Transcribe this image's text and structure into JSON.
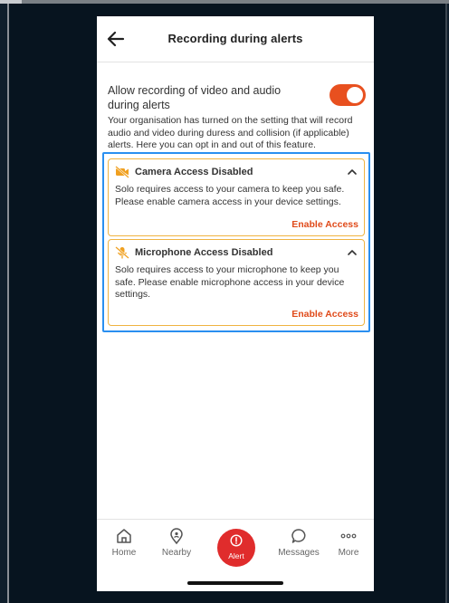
{
  "header": {
    "title": "Recording during alerts",
    "back_icon": "arrow-left-icon"
  },
  "setting": {
    "label": "Allow recording of video and audio during alerts",
    "enabled": true,
    "note": "Your organisation has turned on the setting that will record audio and video during duress and collision (if applicable) alerts. Here you can opt in and out of this feature."
  },
  "cards": [
    {
      "icon": "camera-off-icon",
      "title": "Camera Access Disabled",
      "body": "Solo requires access to your camera to keep you safe. Please enable camera access in your device settings.",
      "action": "Enable Access"
    },
    {
      "icon": "microphone-off-icon",
      "title": "Microphone Access Disabled",
      "body": "Solo requires access to your microphone to keep you safe. Please enable microphone access in your device settings.",
      "action": "Enable Access"
    }
  ],
  "nav": {
    "home": "Home",
    "nearby": "Nearby",
    "alert": "Alert",
    "messages": "Messages",
    "more": "More"
  },
  "colors": {
    "accent": "#e8501f",
    "card_border": "#f0b341",
    "alert_red": "#e02c2c",
    "highlight_blue": "#2a8ff0",
    "background": "#07141f"
  }
}
